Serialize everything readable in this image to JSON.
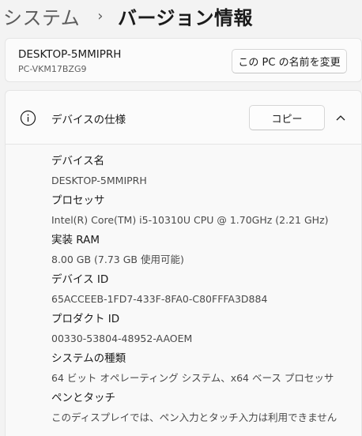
{
  "breadcrumb": {
    "parent": "システム",
    "separator": "›",
    "current": "バージョン情報"
  },
  "pc_card": {
    "device_name": "DESKTOP-5MMIPRH",
    "model": "PC-VKM17BZG9",
    "rename_button": "この PC の名前を変更"
  },
  "spec_card": {
    "title": "デバイスの仕様",
    "copy_button": "コピー",
    "icons": {
      "info": "info-icon",
      "collapse": "chevron-up-icon"
    },
    "items": [
      {
        "label": "デバイス名",
        "value": "DESKTOP-5MMIPRH"
      },
      {
        "label": "プロセッサ",
        "value": "Intel(R) Core(TM) i5-10310U CPU @ 1.70GHz   (2.21 GHz)"
      },
      {
        "label": "実装 RAM",
        "value": "8.00 GB (7.73 GB 使用可能)"
      },
      {
        "label": "デバイス ID",
        "value": "65ACCEEB-1FD7-433F-8FA0-C80FFFA3D884"
      },
      {
        "label": "プロダクト ID",
        "value": "00330-53804-48952-AAOEM"
      },
      {
        "label": "システムの種類",
        "value": "64 ビット オペレーティング システム、x64 ベース プロセッサ"
      },
      {
        "label": "ペンとタッチ",
        "value": "このディスプレイでは、ペン入力とタッチ入力は利用できません"
      }
    ]
  }
}
